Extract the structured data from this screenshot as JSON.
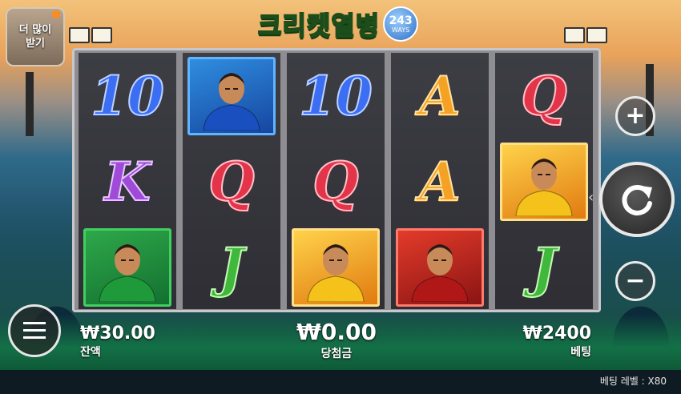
{
  "title": {
    "text": "크리켓열병",
    "ways_number": "243",
    "ways_label": "WAYS"
  },
  "promo": {
    "line1": "더 많이",
    "line2": "받기"
  },
  "reels": [
    [
      {
        "type": "text",
        "value": "10",
        "style": "s10"
      },
      {
        "type": "text",
        "value": "K",
        "style": "sK"
      },
      {
        "type": "card",
        "icon": "green-batsman-icon"
      }
    ],
    [
      {
        "type": "card",
        "icon": "blue-bowler-icon"
      },
      {
        "type": "text",
        "value": "Q",
        "style": "sQ"
      },
      {
        "type": "text",
        "value": "J",
        "style": "sJ"
      }
    ],
    [
      {
        "type": "text",
        "value": "10",
        "style": "s10"
      },
      {
        "type": "text",
        "value": "Q",
        "style": "sQ"
      },
      {
        "type": "card",
        "icon": "yellow-captain-icon"
      }
    ],
    [
      {
        "type": "text",
        "value": "A",
        "style": "sA"
      },
      {
        "type": "text",
        "value": "A",
        "style": "sA"
      },
      {
        "type": "card",
        "icon": "red-batsman-icon"
      }
    ],
    [
      {
        "type": "text",
        "value": "Q",
        "style": "sQ"
      },
      {
        "type": "card",
        "icon": "yellow-captain-icon"
      },
      {
        "type": "text",
        "value": "J",
        "style": "sJ"
      }
    ]
  ],
  "hud": {
    "balance_value": "₩30.00",
    "balance_label": "잔액",
    "win_value": "₩0.00",
    "win_label": "당첨금",
    "bet_value": "₩2400",
    "bet_label": "베팅"
  },
  "bet_level": {
    "label": "베팅 레벨",
    "separator": " : ",
    "value": "X80"
  },
  "controls": {
    "plus": "+",
    "minus": "−"
  }
}
